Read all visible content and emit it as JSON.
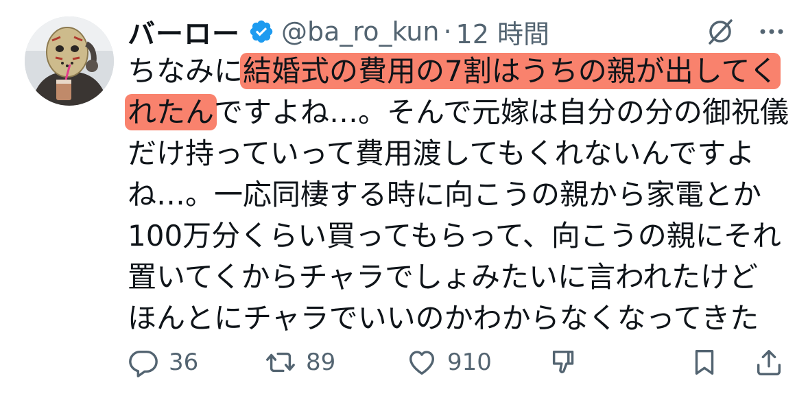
{
  "tweet": {
    "display_name": "バーロー",
    "handle": "@ba_ro_kun",
    "separator": "·",
    "time": "12 時間",
    "text_lines": [
      {
        "pre": "ちなみに",
        "hl": "結婚式の費用の7割はうちの親が出してく",
        "post": ""
      },
      {
        "pre": "",
        "hl": "れたん",
        "post": "ですよね…。そんで元嫁は自分の分の御祝儀"
      },
      {
        "pre": "",
        "hl": "",
        "post": "だけ持っていって費用渡してもくれないんですよ"
      },
      {
        "pre": "",
        "hl": "",
        "post": "ね…。一応同棲する時に向こうの親から家電とか"
      },
      {
        "pre": "",
        "hl": "",
        "post": "100万分くらい買ってもらって、向こうの親にそれ"
      },
      {
        "pre": "",
        "hl": "",
        "post": "置いてくからチャラでしょみたいに言われたけど"
      },
      {
        "pre": "",
        "hl": "",
        "post": "ほんとにチャラでいいのかわからなくなってきた"
      }
    ],
    "highlight_color": "#f9826d",
    "verified_color": "#1d9bf0"
  },
  "actions": {
    "replies": "36",
    "reposts": "89",
    "likes": "910"
  },
  "icons": [
    "verified-badge-icon",
    "grok-icon",
    "more-icon",
    "reply-icon",
    "repost-icon",
    "like-icon",
    "dislike-icon",
    "bookmark-icon",
    "share-icon"
  ]
}
